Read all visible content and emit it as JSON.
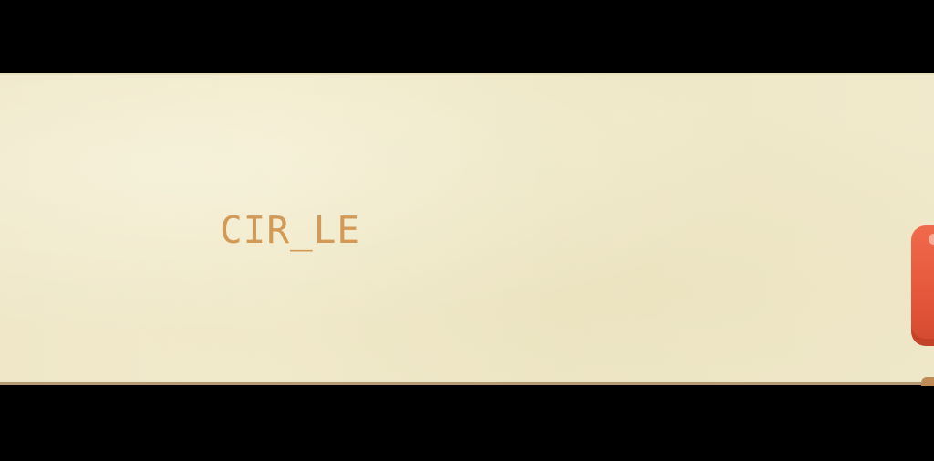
{
  "game": {
    "word": "CIR_LE"
  },
  "colors": {
    "letterbox": "#000000",
    "board": "#efe7c8",
    "word_text": "#d39a57",
    "tile": "#e4563b"
  },
  "icons": {
    "tile": "red-letter-tile-icon"
  }
}
